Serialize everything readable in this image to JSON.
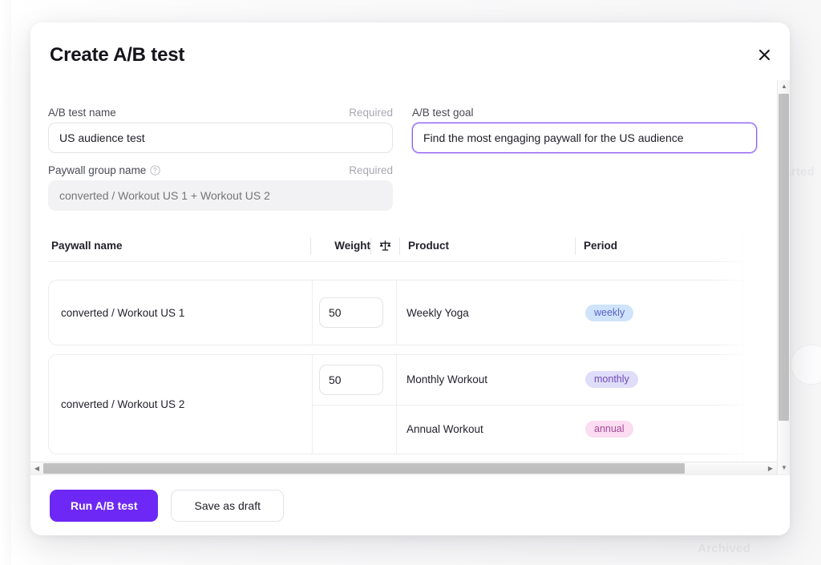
{
  "background": {
    "ghost_labels": [
      "Started",
      "Archived"
    ]
  },
  "modal": {
    "title": "Create A/B test",
    "close_icon": "close-icon",
    "form": {
      "name_field": {
        "label": "A/B test name",
        "required_tag": "Required",
        "value": "US audience test",
        "placeholder": ""
      },
      "group_field": {
        "label": "Paywall group name",
        "help_icon": "help-circle-icon",
        "required_tag": "Required",
        "value": "",
        "placeholder": "converted / Workout US 1 + Workout US 2"
      },
      "goal_field": {
        "label": "A/B test goal",
        "value": "Find the most engaging paywall for the US audience",
        "placeholder": ""
      }
    },
    "table": {
      "headers": {
        "paywall_name": "Paywall name",
        "weight": "Weight",
        "weight_icon": "balance-scale-icon",
        "product": "Product",
        "period": "Period"
      },
      "rows": [
        {
          "paywall_name": "converted / Workout US 1",
          "weight": "50",
          "products": [
            {
              "product": "Weekly Yoga",
              "period": "weekly",
              "period_style": "weekly"
            }
          ]
        },
        {
          "paywall_name": "converted / Workout US 2",
          "weight": "50",
          "products": [
            {
              "product": "Monthly Workout",
              "period": "monthly",
              "period_style": "monthly"
            },
            {
              "product": "Annual Workout",
              "period": "annual",
              "period_style": "annual"
            }
          ]
        }
      ]
    },
    "footer": {
      "primary_label": "Run A/B test",
      "secondary_label": "Save as draft"
    },
    "scrollbars": {
      "horizontal": {
        "left_arrow": "◀",
        "right_arrow": "▶"
      },
      "vertical": {
        "up_arrow": "▲",
        "down_arrow": "▼"
      }
    }
  },
  "colors": {
    "accent": "#6d28f5",
    "focus_border": "#8a5cf6",
    "badge_weekly_bg": "#cfe4fb",
    "badge_weekly_fg": "#5b62c8",
    "badge_monthly_bg": "#e0ddfa",
    "badge_monthly_fg": "#6f49b8",
    "badge_annual_bg": "#fbdcf0",
    "badge_annual_fg": "#a64a9a"
  }
}
